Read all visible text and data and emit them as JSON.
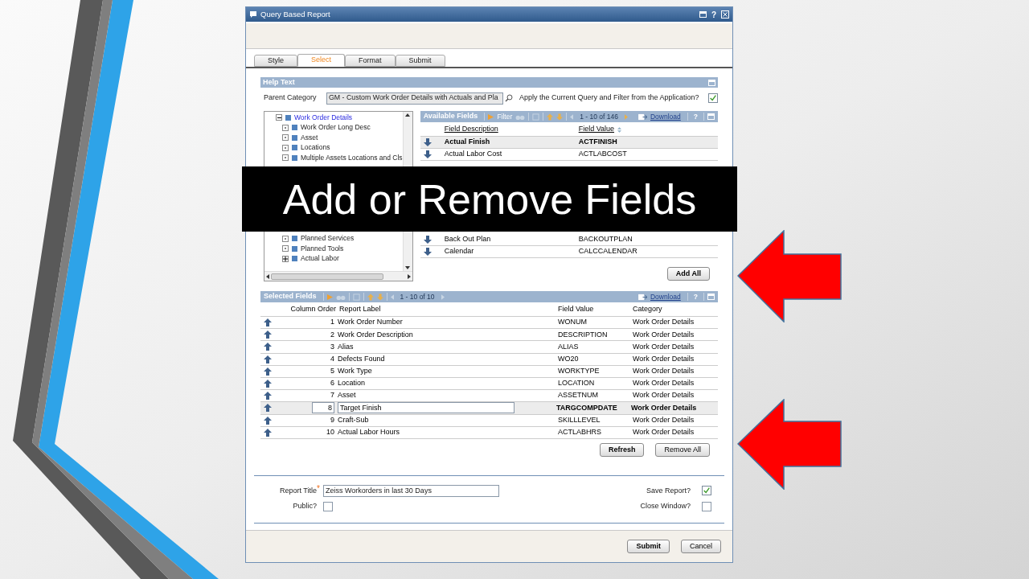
{
  "slide": {
    "banner": "Add or Remove Fields"
  },
  "window": {
    "title": "Query Based Report",
    "help": "?"
  },
  "tabs": [
    {
      "label": "Style",
      "selected": false
    },
    {
      "label": "Select",
      "selected": true
    },
    {
      "label": "Format",
      "selected": false
    },
    {
      "label": "Submit",
      "selected": false
    }
  ],
  "help_text": {
    "title": "Help Text"
  },
  "parent_category": {
    "label": "Parent Category",
    "value": "GM - Custom Work Order Details with Actuals and Pla"
  },
  "apply_query": {
    "label": "Apply the Current Query and Filter from the Application?",
    "checked": true
  },
  "tree": [
    {
      "label": "Work Order Details",
      "selected": true,
      "expanded": true,
      "children": [
        {
          "label": "Work Order Long Desc",
          "selected": false,
          "expanded": false,
          "expandable": false
        },
        {
          "label": "Asset",
          "selected": false,
          "expanded": false,
          "expandable": false
        },
        {
          "label": "Locations",
          "selected": false,
          "expanded": false,
          "expandable": false
        },
        {
          "label": "Multiple Assets Locations and Cls",
          "selected": false,
          "expanded": false,
          "expandable": false
        },
        {
          "label": "Planned Services",
          "selected": false,
          "expanded": false,
          "expandable": false
        },
        {
          "label": "Planned Tools",
          "selected": false,
          "expanded": false,
          "expandable": false
        },
        {
          "label": "Actual Labor",
          "selected": false,
          "expanded": false,
          "expandable": true
        }
      ]
    }
  ],
  "available_fields": {
    "title": "Available Fields",
    "filter": "Filter",
    "paging": "1 - 10 of 146",
    "download": "Download",
    "help": "?",
    "columns": [
      "Field Description",
      "Field Value"
    ],
    "rows": [
      {
        "description": "Actual Finish",
        "value": "ACTFINISH",
        "selected": true
      },
      {
        "description": "Actual Labor Cost",
        "value": "ACTLABCOST",
        "selected": false
      },
      {
        "description": "Back Out Plan",
        "value": "BACKOUTPLAN",
        "selected": false
      },
      {
        "description": "Calendar",
        "value": "CALCCALENDAR",
        "selected": false
      }
    ],
    "add_all": "Add All"
  },
  "selected_fields": {
    "title": "Selected Fields",
    "paging": "1 - 10 of 10",
    "download": "Download",
    "help": "?",
    "columns": [
      "Column Order",
      "Report Label",
      "Field Value",
      "Category"
    ],
    "rows": [
      {
        "order": "1",
        "label": "Work Order Number",
        "value": "WONUM",
        "category": "Work Order Details",
        "selected": false
      },
      {
        "order": "2",
        "label": "Work Order Description",
        "value": "DESCRIPTION",
        "category": "Work Order Details",
        "selected": false
      },
      {
        "order": "3",
        "label": "Alias",
        "value": "ALIAS",
        "category": "Work Order Details",
        "selected": false
      },
      {
        "order": "4",
        "label": "Defects Found",
        "value": "WO20",
        "category": "Work Order Details",
        "selected": false
      },
      {
        "order": "5",
        "label": "Work Type",
        "value": "WORKTYPE",
        "category": "Work Order Details",
        "selected": false
      },
      {
        "order": "6",
        "label": "Location",
        "value": "LOCATION",
        "category": "Work Order Details",
        "selected": false
      },
      {
        "order": "7",
        "label": "Asset",
        "value": "ASSETNUM",
        "category": "Work Order Details",
        "selected": false
      },
      {
        "order": "8",
        "label": "Target Finish",
        "value": "TARGCOMPDATE",
        "category": "Work Order Details",
        "selected": true
      },
      {
        "order": "9",
        "label": "Craft-Sub",
        "value": "SKILLLEVEL",
        "category": "Work Order Details",
        "selected": false
      },
      {
        "order": "10",
        "label": "Actual Labor Hours",
        "value": "ACTLABHRS",
        "category": "Work Order Details",
        "selected": false
      }
    ],
    "buttons": [
      "Refresh",
      "Remove All"
    ]
  },
  "report": {
    "title_label": "Report Title",
    "required_mark": "*",
    "title_value": "Zeiss Workorders in last 30 Days",
    "public": {
      "label": "Public?",
      "checked": false
    },
    "save": {
      "label": "Save Report?",
      "checked": true
    },
    "close": {
      "label": "Close Window?",
      "checked": false
    }
  },
  "footer_buttons": [
    "Submit",
    "Cancel"
  ]
}
